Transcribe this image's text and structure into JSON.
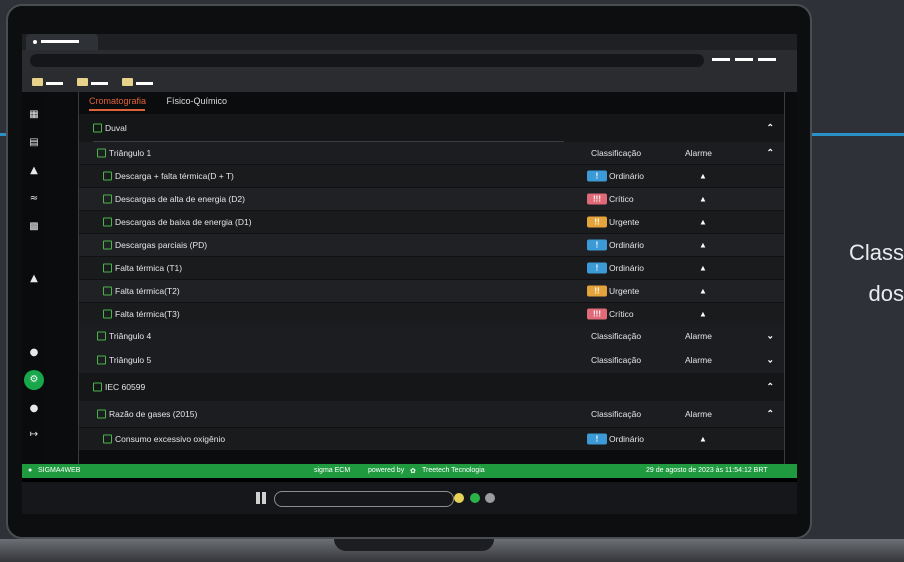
{
  "background": {
    "side_text_line1": "Class",
    "side_text_line2": "dos"
  },
  "tabs": [
    {
      "label": "Cromatografia",
      "active": true
    },
    {
      "label": "Físico-Químico",
      "active": false
    }
  ],
  "sidebar_icons": [
    "dashboard-icon",
    "chat-icon",
    "bell-icon",
    "wifi-icon",
    "document-icon",
    "lab-icon",
    "help-icon",
    "settings-icon",
    "user-icon",
    "logout-icon"
  ],
  "groups": {
    "duval": {
      "label": "Duval",
      "triangulo1": {
        "label": "Triângulo 1",
        "col_class": "Classificação",
        "col_alarm": "Alarme",
        "items": [
          {
            "label": "Descarga + falta térmica(D + T)",
            "badge": "!",
            "classification": "Ordinário",
            "level": "ordinario"
          },
          {
            "label": "Descargas de alta de energia (D2)",
            "badge": "!!!",
            "classification": "Crítico",
            "level": "critico"
          },
          {
            "label": "Descargas de baixa de energia (D1)",
            "badge": "!!",
            "classification": "Urgente",
            "level": "urgente"
          },
          {
            "label": "Descargas parciais (PD)",
            "badge": "!",
            "classification": "Ordinário",
            "level": "ordinario"
          },
          {
            "label": "Falta térmica (T1)",
            "badge": "!",
            "classification": "Ordinário",
            "level": "ordinario"
          },
          {
            "label": "Falta térmica(T2)",
            "badge": "!!",
            "classification": "Urgente",
            "level": "urgente"
          },
          {
            "label": "Falta térmica(T3)",
            "badge": "!!!",
            "classification": "Crítico",
            "level": "critico"
          }
        ]
      },
      "triangulo4": {
        "label": "Triângulo 4",
        "col_class": "Classificação",
        "col_alarm": "Alarme"
      },
      "triangulo5": {
        "label": "Triângulo 5",
        "col_class": "Classificação",
        "col_alarm": "Alarme"
      }
    },
    "iec": {
      "label": "IEC 60599",
      "razao": {
        "label": "Razão de gases (2015)",
        "col_class": "Classificação",
        "col_alarm": "Alarme",
        "items": [
          {
            "label": "Consumo excessivo oxigênio",
            "badge": "!",
            "classification": "Ordinário",
            "level": "ordinario"
          }
        ]
      }
    }
  },
  "status_bar": {
    "user": "SIGMA4WEB",
    "brand": "sigma ECM",
    "powered": "powered by",
    "company": "Treetech Tecnologia",
    "datetime": "29 de agosto de 2023 às 11:54:12 BRT"
  },
  "colors": {
    "ordinario": "#3c9ad6",
    "urgente": "#e5a33b",
    "critico": "#e06a78",
    "accent_green": "#1f9a3f",
    "tab_active": "#e0623a",
    "dock_yellow": "#e8d35a",
    "dock_green": "#2bb34a",
    "dock_gray": "#9a9ca0"
  }
}
